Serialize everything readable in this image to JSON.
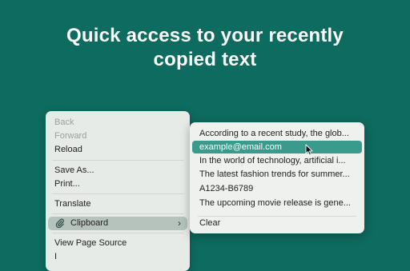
{
  "headline": {
    "line1": "Quick access to your recently",
    "line2": "copied text"
  },
  "context_menu": {
    "back": "Back",
    "forward": "Forward",
    "reload": "Reload",
    "save_as": "Save As...",
    "print": "Print...",
    "translate": "Translate",
    "clipboard": "Clipboard",
    "view_source": "View Page Source",
    "partial_item": "I"
  },
  "clipboard_submenu": {
    "items": [
      "According to a recent study, the glob...",
      "example@email.com",
      "In the world of technology, artificial i...",
      "The latest fashion trends for summer...",
      "A1234-B6789",
      "The upcoming movie release is gene..."
    ],
    "highlighted_index": 1,
    "clear": "Clear"
  },
  "colors": {
    "background": "#0e6b5f",
    "highlight": "#3a9a8c",
    "menu_bg": "#e6ebe7"
  },
  "icons": {
    "clipboard": "paperclip-icon",
    "submenu_arrow": "chevron-right-icon",
    "pointer": "mouse-cursor-icon"
  }
}
